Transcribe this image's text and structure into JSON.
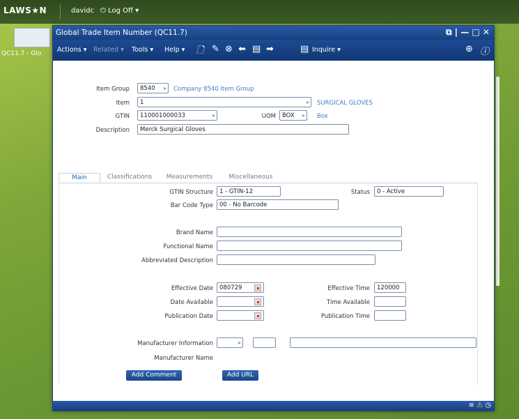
{
  "topbar": {
    "logo": "LAWS★N",
    "user": "davidc",
    "logoff": "⏻ Log Off ▾"
  },
  "left_tab": {
    "label": "QC11.7 - Glo"
  },
  "window": {
    "title": "Global Trade Item Number (QC11.7)",
    "controls": "⧉ | — □ ✕"
  },
  "menu": {
    "actions": "Actions ▾",
    "related": "Related ▾",
    "tools": "Tools ▾",
    "help": "Help ▾",
    "inquire": "Inquire ▾"
  },
  "form": {
    "item_group": {
      "label": "Item Group",
      "value": "8540",
      "link": "Company 8540 Item Group"
    },
    "item": {
      "label": "Item",
      "value": "1",
      "link": "SURGICAL GLOVES"
    },
    "gtin": {
      "label": "GTIN",
      "value": "110001000033"
    },
    "uom": {
      "label": "UOM",
      "value": "BOX",
      "link": "Box"
    },
    "description": {
      "label": "Description",
      "value": "Merck Surgical Gloves"
    }
  },
  "tabs": [
    "Main",
    "Classifications",
    "Measurements",
    "Miscellaneous"
  ],
  "main": {
    "gtin_structure": {
      "label": "GTIN Structure",
      "value": "1 - GTIN-12"
    },
    "status": {
      "label": "Status",
      "value": "0 - Active"
    },
    "bar_code_type": {
      "label": "Bar Code Type",
      "value": "00 - No Barcode"
    },
    "brand_name": {
      "label": "Brand Name",
      "value": ""
    },
    "functional_name": {
      "label": "Functional Name",
      "value": ""
    },
    "abbreviated_description": {
      "label": "Abbreviated Description",
      "value": ""
    },
    "effective_date": {
      "label": "Effective Date",
      "value": "080729"
    },
    "effective_time": {
      "label": "Effective Time",
      "value": "120000"
    },
    "date_available": {
      "label": "Date Available",
      "value": ""
    },
    "time_available": {
      "label": "Time Available",
      "value": ""
    },
    "publication_date": {
      "label": "Publication Date",
      "value": ""
    },
    "publication_time": {
      "label": "Publication Time",
      "value": ""
    },
    "manufacturer_information": {
      "label": "Manufacturer Information"
    },
    "manufacturer_name": {
      "label": "Manufacturer Name"
    },
    "add_comment": "Add Comment",
    "add_url": "Add URL"
  },
  "colors": {
    "window_blue": "#1c4a94",
    "link_blue": "#3d7cc9",
    "desktop_green": "#7fa63a"
  }
}
